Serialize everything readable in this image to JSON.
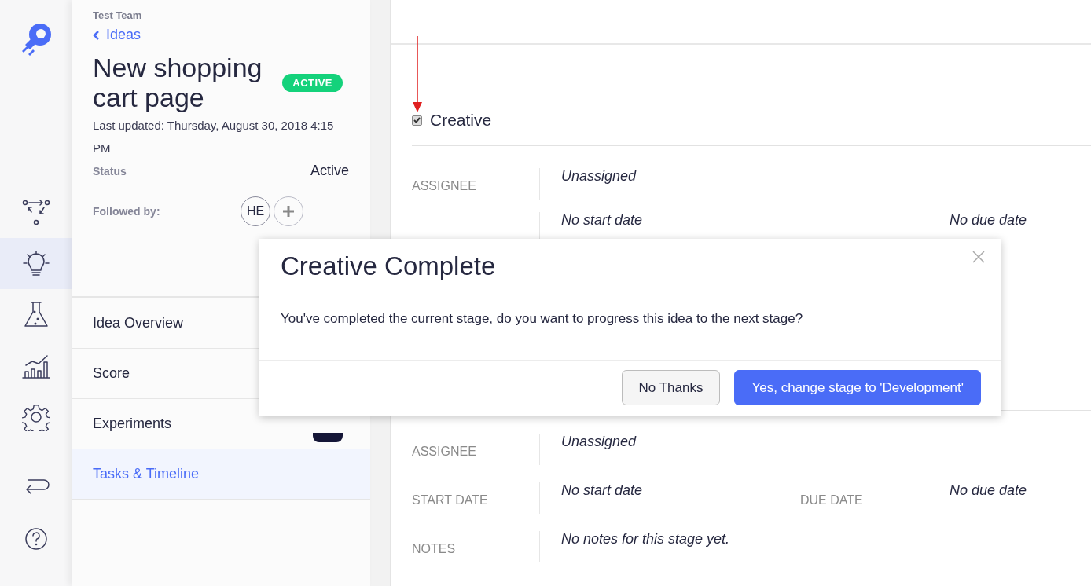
{
  "rail": {
    "items": [
      {
        "kind": "workflow",
        "selected": false
      },
      {
        "kind": "idea",
        "selected": true
      },
      {
        "kind": "flask",
        "selected": false
      },
      {
        "kind": "chart",
        "selected": false
      },
      {
        "kind": "gear",
        "selected": false
      },
      {
        "kind": "back",
        "selected": false
      },
      {
        "kind": "help",
        "selected": false
      }
    ]
  },
  "panel": {
    "team": "Test Team",
    "back_link": "Ideas",
    "title": "New shopping cart page",
    "badge": "ACTIVE",
    "last_updated": "Last updated: Thursday, August 30, 2018 4:15 PM",
    "status_label": "Status",
    "status_value": "Active",
    "followed_label": "Followed by:",
    "followers": [
      {
        "initials": "HE"
      }
    ],
    "nav": [
      {
        "label": "Idea Overview",
        "selected": false
      },
      {
        "label": "Score",
        "selected": false
      },
      {
        "label": "Experiments",
        "selected": false,
        "badge": true
      },
      {
        "label": "Tasks & Timeline",
        "selected": true
      }
    ]
  },
  "main": {
    "stages": [
      {
        "name": "Creative",
        "checked": true,
        "rows": [
          {
            "cells": [
              {
                "label": "ASSIGNEE",
                "value": "Unassigned"
              }
            ]
          },
          {
            "cells": [
              {
                "value": "No start date"
              },
              {
                "value": "No due date"
              }
            ]
          }
        ]
      },
      {
        "rows": [
          {
            "cells": [
              {
                "label": "ASSIGNEE",
                "value": "Unassigned"
              }
            ]
          },
          {
            "cells": [
              {
                "label": "START DATE",
                "value": "No start date"
              },
              {
                "label": "DUE DATE",
                "value": "No due date"
              }
            ]
          },
          {
            "cells": [
              {
                "label": "NOTES",
                "value": "No notes for this stage yet."
              }
            ]
          }
        ]
      }
    ]
  },
  "dialog": {
    "title": "Creative Complete",
    "message": "You've completed the current stage, do you want to progress this idea to the next stage?",
    "buttons": [
      {
        "label": "No Thanks",
        "kind": "secondary"
      },
      {
        "label": "Yes, change stage to 'Development'",
        "kind": "primary"
      }
    ]
  }
}
